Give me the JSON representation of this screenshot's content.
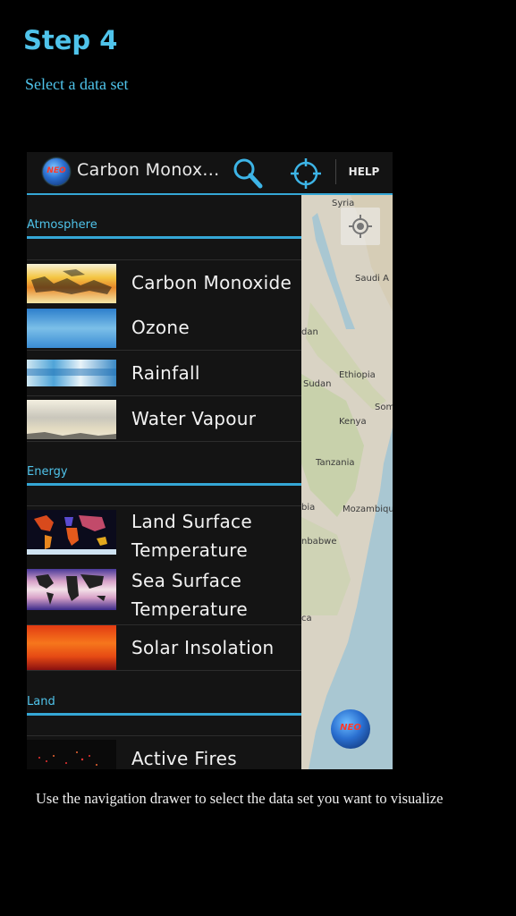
{
  "step": {
    "title": "Step 4",
    "subtitle": "Select a data set"
  },
  "actionbar": {
    "logo_text": "NEO",
    "title": "Carbon Monox...",
    "help_label": "HELP",
    "icons": [
      "search-icon",
      "locate-icon"
    ]
  },
  "map": {
    "labels": [
      "Syria",
      "Saudi A",
      "dan",
      "Ethiopia",
      "Sudan",
      "Som",
      "Kenya",
      "Tanzania",
      "bia",
      "Mozambiqu",
      "nbabwe",
      "ca"
    ],
    "logo_text": "NEO"
  },
  "drawer": {
    "sections": [
      {
        "header": "Atmosphere",
        "items": [
          "Carbon Monoxide",
          "Ozone",
          "Rainfall",
          "Water Vapour"
        ]
      },
      {
        "header": "Energy",
        "items": [
          "Land Surface Temperature",
          "Sea Surface Temperature",
          "Solar Insolation"
        ]
      },
      {
        "header": "Land",
        "items": [
          "Active Fires"
        ]
      }
    ]
  },
  "caption": "Use the navigation drawer to select the data set you want to visualize",
  "colors": {
    "accent": "#35a7d6",
    "background": "#000000",
    "drawer": "#141414"
  }
}
